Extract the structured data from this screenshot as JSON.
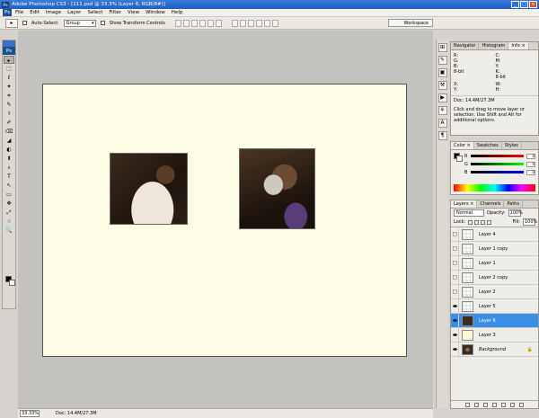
{
  "window": {
    "title": "Adobe Photoshop CS3 - [111.psd @ 33.3% (Layer 6, RGB/8#)]",
    "controls": [
      "_",
      "□",
      "×"
    ]
  },
  "menu": [
    "File",
    "Edit",
    "Image",
    "Layer",
    "Select",
    "Filter",
    "View",
    "Window",
    "Help"
  ],
  "options": {
    "auto_select_label": "Auto-Select:",
    "auto_select_value": "Group",
    "show_transform_label": "Show Transform Controls",
    "workspace_label": "Workspace"
  },
  "toolbox": {
    "logo": "Ps",
    "tools": [
      "▸",
      "⬚",
      "ℓ",
      "✦",
      "⌗",
      "✎",
      "⚕",
      "✐",
      "⌫",
      "◢",
      "◐",
      "⬆",
      "⌕",
      "T",
      "↖",
      "▭",
      "✥",
      "⤢",
      "☝",
      "🔍"
    ]
  },
  "status": {
    "zoom": "33.33%",
    "doc": "Doc: 14.4M/27.3M"
  },
  "navigator": {
    "tabs": [
      "Navigator",
      "Histogram",
      "Info ×"
    ],
    "info": {
      "r": "R:",
      "g": "G:",
      "b": "B:",
      "c": "C:",
      "m": "M:",
      "y": "Y:",
      "k": "K:",
      "bit1": "8-bit",
      "bit2": "8-bit",
      "x": "X:",
      "yy": "Y:",
      "w": "W:",
      "h": "H:"
    },
    "doc": "Doc: 14.4M/27.3M",
    "desc": "Click and drag to move layer or selection. Use Shift and Alt for additional options."
  },
  "color_panel": {
    "tabs": [
      "Color ×",
      "Swatches",
      "Styles"
    ],
    "channels": [
      {
        "ch": "R",
        "value": "0",
        "from": "#000000",
        "to": "#ff0000"
      },
      {
        "ch": "G",
        "value": "0",
        "from": "#000000",
        "to": "#00ff00"
      },
      {
        "ch": "B",
        "value": "0",
        "from": "#000000",
        "to": "#0000ff"
      }
    ]
  },
  "layers_panel": {
    "tabs": [
      "Layers ×",
      "Channels",
      "Paths"
    ],
    "blend_mode": "Normal",
    "opacity_label": "Opacity:",
    "opacity": "100%",
    "lock_label": "Lock:",
    "fill_label": "Fill:",
    "fill": "100%",
    "layers": [
      {
        "name": "Layer 4",
        "visible": false,
        "thumb": "",
        "active": false
      },
      {
        "name": "Layer 1 copy",
        "visible": false,
        "thumb": "",
        "active": false
      },
      {
        "name": "Layer 1",
        "visible": false,
        "thumb": "",
        "active": false
      },
      {
        "name": "Layer 2 copy",
        "visible": false,
        "thumb": "",
        "active": false
      },
      {
        "name": "Layer 2",
        "visible": false,
        "thumb": "",
        "active": false
      },
      {
        "name": "Layer 5",
        "visible": true,
        "thumb": "",
        "active": false
      },
      {
        "name": "Layer 6",
        "visible": true,
        "thumb": "dark",
        "active": true
      },
      {
        "name": "Layer 3",
        "visible": true,
        "thumb": "cream",
        "active": false
      },
      {
        "name": "Background",
        "visible": true,
        "thumb": "bg",
        "active": false,
        "italic": true,
        "locked": true
      }
    ]
  }
}
